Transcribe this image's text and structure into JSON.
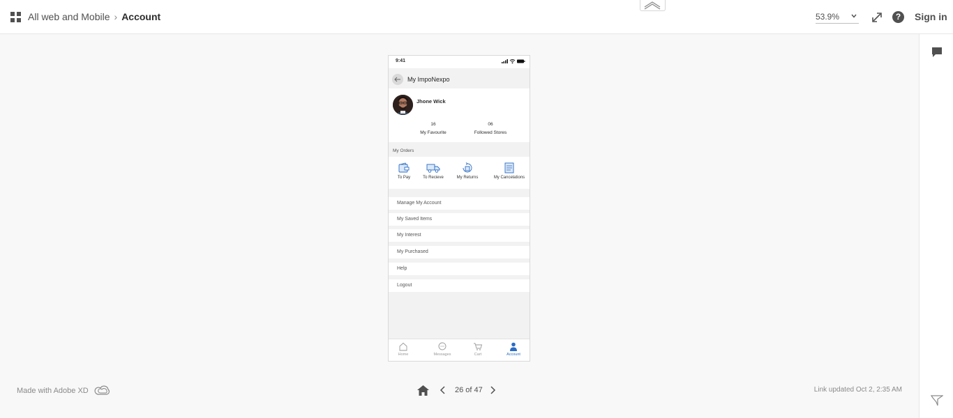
{
  "header": {
    "breadcrumb_parent": "All web and Mobile",
    "breadcrumb_current": "Account",
    "zoom_value": "53.9%",
    "signin_label": "Sign in",
    "help_glyph": "?"
  },
  "phone": {
    "status_time": "9:41",
    "nav_title": "My ImpoNexpo",
    "user_name": "Jhone Wick",
    "stats": [
      {
        "value": "16",
        "label": "My Favourite"
      },
      {
        "value": "06",
        "label": "Followed Stores"
      }
    ],
    "orders_heading": "My Orders",
    "orders": [
      {
        "label": "To Pay",
        "icon": "wallet-icon"
      },
      {
        "label": "To Recieve",
        "icon": "truck-icon"
      },
      {
        "label": "My Returns",
        "icon": "return-icon"
      },
      {
        "label": "My Cancelations",
        "icon": "cancel-box-icon"
      }
    ],
    "menu": [
      "Manage My Account",
      "My Saved Items",
      "My Interest",
      "My Purchased",
      "Help",
      "Logout"
    ],
    "tabs": [
      {
        "label": "Home",
        "icon": "home-icon"
      },
      {
        "label": "Messages",
        "icon": "messages-icon"
      },
      {
        "label": "Cart",
        "icon": "cart-icon"
      },
      {
        "label": "Account",
        "icon": "account-icon"
      }
    ],
    "accent_color": "#2b6cc4"
  },
  "footer": {
    "made_with": "Made with Adobe XD",
    "page_indicator": "26 of 47",
    "link_updated": "Link updated Oct 2, 2:35 AM"
  }
}
